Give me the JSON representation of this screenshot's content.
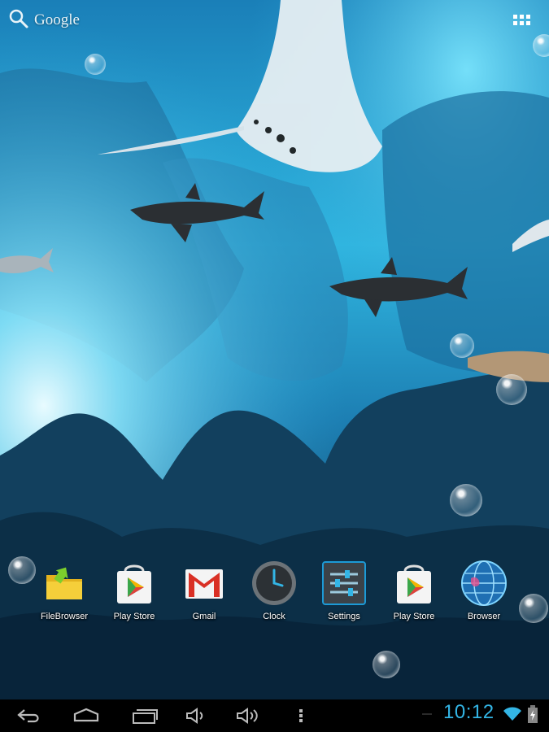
{
  "search": {
    "label": "Google",
    "icon": "search-icon"
  },
  "apps_button": {
    "icon": "apps-grid-icon"
  },
  "hotseat": {
    "apps": [
      {
        "label": "FileBrowser",
        "icon": "file-browser-icon"
      },
      {
        "label": "Play Store",
        "icon": "play-store-icon"
      },
      {
        "label": "Gmail",
        "icon": "gmail-icon"
      },
      {
        "label": "Clock",
        "icon": "clock-icon"
      },
      {
        "label": "Settings",
        "icon": "settings-icon"
      },
      {
        "label": "Play Store",
        "icon": "play-store-icon"
      },
      {
        "label": "Browser",
        "icon": "browser-globe-icon"
      }
    ]
  },
  "navbar": {
    "buttons": [
      "back-icon",
      "home-icon",
      "recent-apps-icon",
      "volume-down-icon",
      "volume-up-icon",
      "menu-icon"
    ]
  },
  "status": {
    "time": "10:12",
    "wifi": "wifi-icon",
    "battery": "battery-charging-icon"
  },
  "colors": {
    "accent": "#33b5e5",
    "water_light": "#5fd8f6",
    "water_deep": "#0a3350"
  }
}
